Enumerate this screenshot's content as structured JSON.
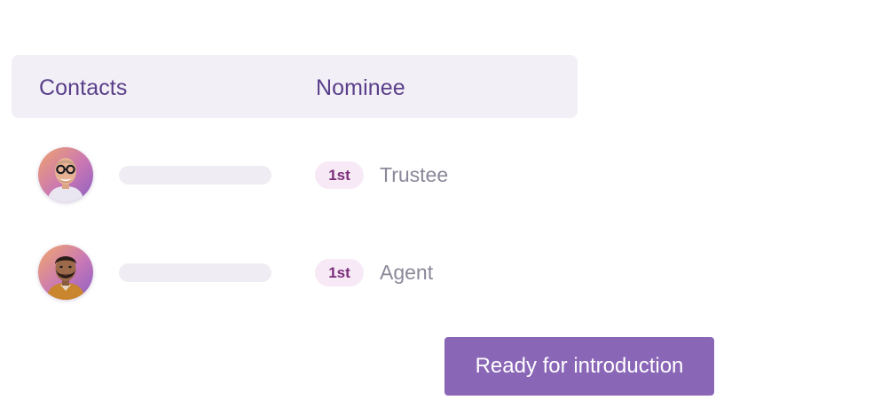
{
  "table": {
    "headers": {
      "contacts": "Contacts",
      "nominee": "Nominee"
    },
    "rows": [
      {
        "avatar": "contact-avatar-glasses",
        "badge": "1st",
        "role": "Trustee"
      },
      {
        "avatar": "contact-avatar-beard",
        "badge": "1st",
        "role": "Agent"
      }
    ]
  },
  "action": {
    "label": "Ready for introduction"
  },
  "colors": {
    "accent": "#8a66b7",
    "header_text": "#5a3f8a",
    "header_bg": "#f2eff6",
    "badge_bg": "#f8e9f7",
    "badge_text": "#7a2f7a",
    "role_text": "#8b8799"
  }
}
